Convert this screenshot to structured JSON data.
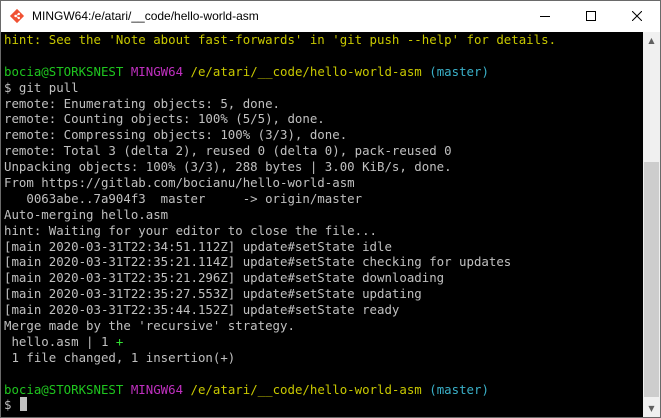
{
  "window": {
    "title": "MINGW64:/e/atari/__code/hello-world-asm",
    "controls": {
      "minimize": "─",
      "maximize": "☐",
      "close": "✕"
    }
  },
  "colors": {
    "background": "#000000",
    "text": "#c0c0c0",
    "user_host": "#1fc61f",
    "shell_tag": "#c030c0",
    "path": "#c8c800",
    "branch": "#3ab0c8",
    "hint": "#c8c800",
    "insert_plus": "#32e032"
  },
  "terminal": {
    "lines": [
      [
        {
          "t": "hint: See the 'Note about fast-forwards' in 'git push --help' for details.",
          "c": "yellow"
        }
      ],
      [
        {
          "t": "",
          "c": "default"
        }
      ],
      [
        {
          "t": "bocia@STORKSNEST",
          "c": "green"
        },
        {
          "t": " ",
          "c": "default"
        },
        {
          "t": "MINGW64",
          "c": "magenta"
        },
        {
          "t": " ",
          "c": "default"
        },
        {
          "t": "/e/atari/__code/hello-world-asm",
          "c": "yellow"
        },
        {
          "t": " ",
          "c": "default"
        },
        {
          "t": "(master)",
          "c": "cyan"
        }
      ],
      [
        {
          "t": "$ git pull",
          "c": "default"
        }
      ],
      [
        {
          "t": "remote: Enumerating objects: 5, done.",
          "c": "default"
        }
      ],
      [
        {
          "t": "remote: Counting objects: 100% (5/5), done.",
          "c": "default"
        }
      ],
      [
        {
          "t": "remote: Compressing objects: 100% (3/3), done.",
          "c": "default"
        }
      ],
      [
        {
          "t": "remote: Total 3 (delta 2), reused 0 (delta 0), pack-reused 0",
          "c": "default"
        }
      ],
      [
        {
          "t": "Unpacking objects: 100% (3/3), 288 bytes | 3.00 KiB/s, done.",
          "c": "default"
        }
      ],
      [
        {
          "t": "From https://gitlab.com/bocianu/hello-world-asm",
          "c": "default"
        }
      ],
      [
        {
          "t": "   0063abe..7a904f3  master     -> origin/master",
          "c": "default"
        }
      ],
      [
        {
          "t": "Auto-merging hello.asm",
          "c": "default"
        }
      ],
      [
        {
          "t": "hint: Waiting for your editor to close the file...",
          "c": "default"
        }
      ],
      [
        {
          "t": "[main 2020-03-31T22:34:51.112Z] update#setState idle",
          "c": "default"
        }
      ],
      [
        {
          "t": "[main 2020-03-31T22:35:21.114Z] update#setState checking for updates",
          "c": "default"
        }
      ],
      [
        {
          "t": "[main 2020-03-31T22:35:21.296Z] update#setState downloading",
          "c": "default"
        }
      ],
      [
        {
          "t": "[main 2020-03-31T22:35:27.553Z] update#setState updating",
          "c": "default"
        }
      ],
      [
        {
          "t": "[main 2020-03-31T22:35:44.152Z] update#setState ready",
          "c": "default"
        }
      ],
      [
        {
          "t": "Merge made by the 'recursive' strategy.",
          "c": "default"
        }
      ],
      [
        {
          "t": " hello.asm | 1 ",
          "c": "default"
        },
        {
          "t": "+",
          "c": "bright-green"
        }
      ],
      [
        {
          "t": " 1 file changed, 1 insertion(+)",
          "c": "default"
        }
      ],
      [
        {
          "t": "",
          "c": "default"
        }
      ],
      [
        {
          "t": "bocia@STORKSNEST",
          "c": "green"
        },
        {
          "t": " ",
          "c": "default"
        },
        {
          "t": "MINGW64",
          "c": "magenta"
        },
        {
          "t": " ",
          "c": "default"
        },
        {
          "t": "/e/atari/__code/hello-world-asm",
          "c": "yellow"
        },
        {
          "t": " ",
          "c": "default"
        },
        {
          "t": "(master)",
          "c": "cyan"
        }
      ],
      [
        {
          "t": "$",
          "c": "default"
        },
        {
          "t": " ",
          "c": "default"
        }
      ]
    ]
  },
  "scrollbar": {
    "up_icon": "▲",
    "down_icon": "▼"
  }
}
